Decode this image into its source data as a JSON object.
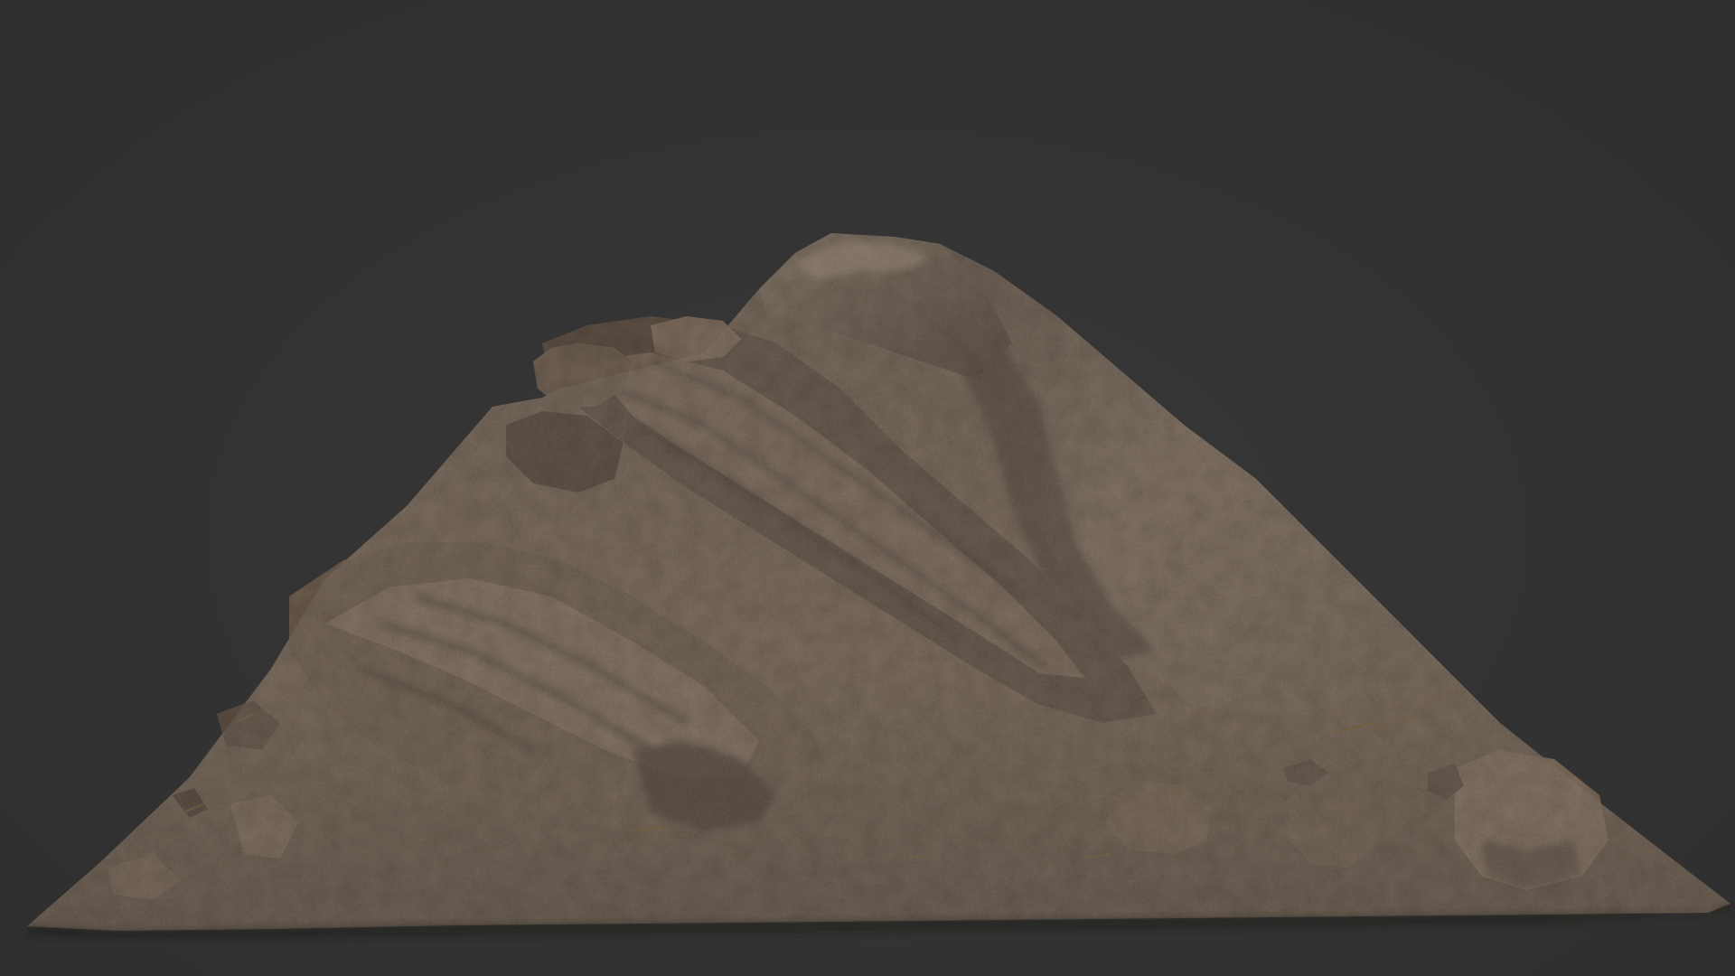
{
  "viewport": {
    "background_color": "#333333"
  },
  "model": {
    "subject": "rock-mountain-terrain",
    "material": "brown-rock",
    "colors": {
      "base": "#6e6053",
      "light": "#8c7d6e",
      "shadow": "#3e352d",
      "deep": "#2a241f",
      "moss": "#6b5a2e"
    }
  }
}
